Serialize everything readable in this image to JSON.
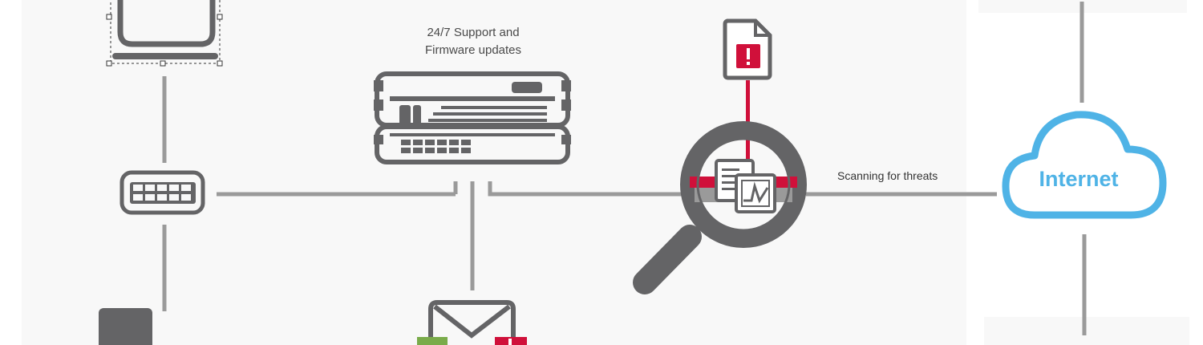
{
  "labels": {
    "support_line1": "24/7 Support and",
    "support_line2": "Firmware updates",
    "scanning": "Scanning for threats",
    "internet": "Internet"
  },
  "colors": {
    "icon_gray": "#646466",
    "line_gray": "#9a9a9a",
    "alert_red": "#d0103a",
    "cloud_blue": "#4fb3e6",
    "badge_green": "#7aab4a"
  }
}
